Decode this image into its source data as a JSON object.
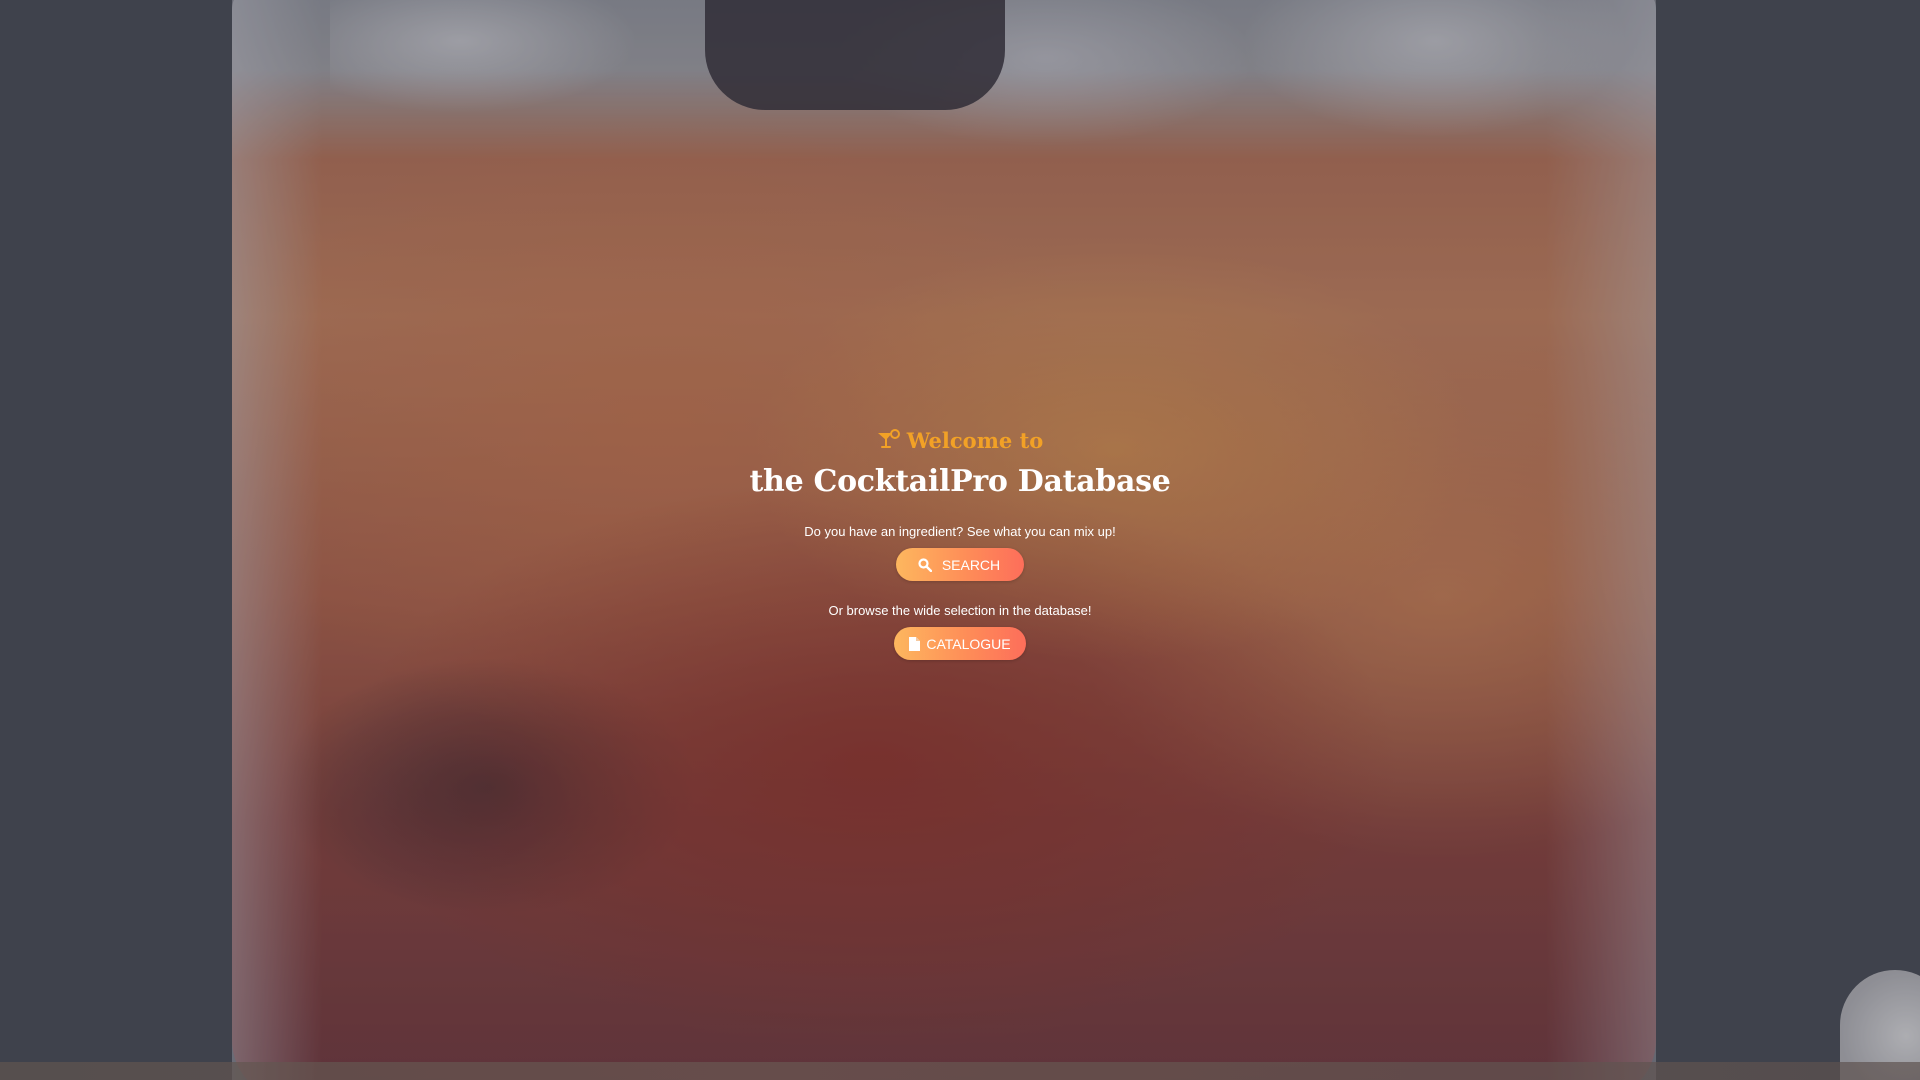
{
  "hero": {
    "welcome": "Welcome to",
    "title": "the CocktailPro Database",
    "search_prompt": "Do you have an ingredient? See what you can mix up!",
    "search_label": "SEARCH",
    "browse_prompt": "Or browse the wide selection in the database!",
    "catalogue_label": "CATALOGUE"
  },
  "icons": {
    "welcome": "cocktail-icon",
    "search": "search-icon",
    "catalogue": "file-icon"
  },
  "colors": {
    "accent": "#f2a126",
    "button_start": "#fdb75e",
    "button_end": "#fd6e5a",
    "title": "#ffffff"
  }
}
